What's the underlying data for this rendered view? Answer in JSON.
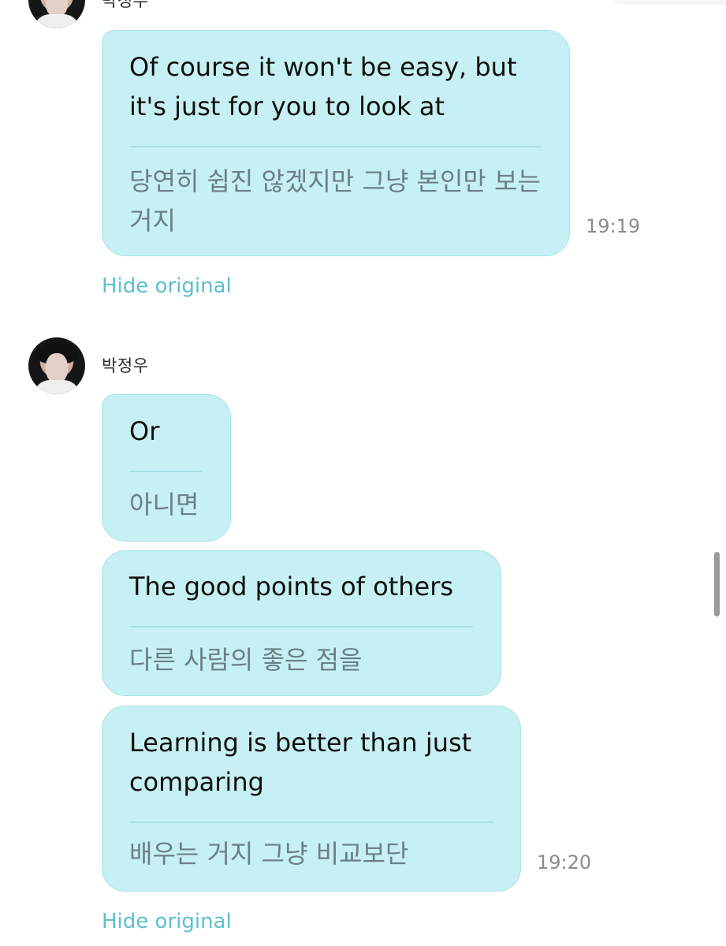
{
  "sender": {
    "name": "박정우"
  },
  "messages": [
    {
      "english": "Of course it won't be easy, but it's just for you to look at",
      "korean": "당연히 쉽진 않겠지만 그냥 본인만 보는거지",
      "time": "19:19"
    },
    {
      "english": "Or",
      "korean": "아니면",
      "time": ""
    },
    {
      "english": "The good points of others",
      "korean": "다른 사람의 좋은 점을",
      "time": ""
    },
    {
      "english": "Learning is better than just comparing",
      "korean": "배우는 거지 그냥 비교보단",
      "time": "19:20"
    }
  ],
  "actions": {
    "hide_original": "Hide original"
  },
  "colors": {
    "bubble": "#c6f0f4",
    "bubble_border": "#a9e3e9",
    "link": "#5cbfcd",
    "translation_text": "#6a7f84"
  },
  "icons": {
    "avatar": "profile-photo"
  }
}
